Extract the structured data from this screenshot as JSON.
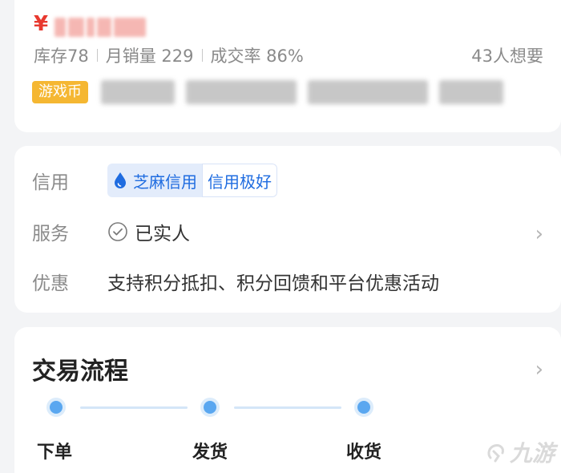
{
  "listing": {
    "currency_symbol": "¥",
    "stats": {
      "stock": "库存78",
      "monthly_sales": "月销量 229",
      "conversion_rate": "成交率 86%"
    },
    "wants": "43人想要",
    "category_tag": "游戏币"
  },
  "info": {
    "credit": {
      "label": "信用",
      "provider": "芝麻信用",
      "level": "信用极好",
      "icon": "water-drop-icon"
    },
    "service": {
      "label": "服务",
      "value": "已实人",
      "icon": "check-circle-icon"
    },
    "promotion": {
      "label": "优惠",
      "value": "支持积分抵扣、积分回馈和平台优惠活动"
    }
  },
  "trade_flow": {
    "title": "交易流程",
    "steps": [
      {
        "label": "下单"
      },
      {
        "label": "发货"
      },
      {
        "label": "收货"
      }
    ]
  },
  "colors": {
    "price": "#e8392f",
    "tag_bg": "#f5b732",
    "credit_blue": "#1f6ce0",
    "step_blue": "#5aa7f0"
  },
  "watermark": {
    "text": "九游",
    "icon": "jiuyou-logo-icon"
  }
}
